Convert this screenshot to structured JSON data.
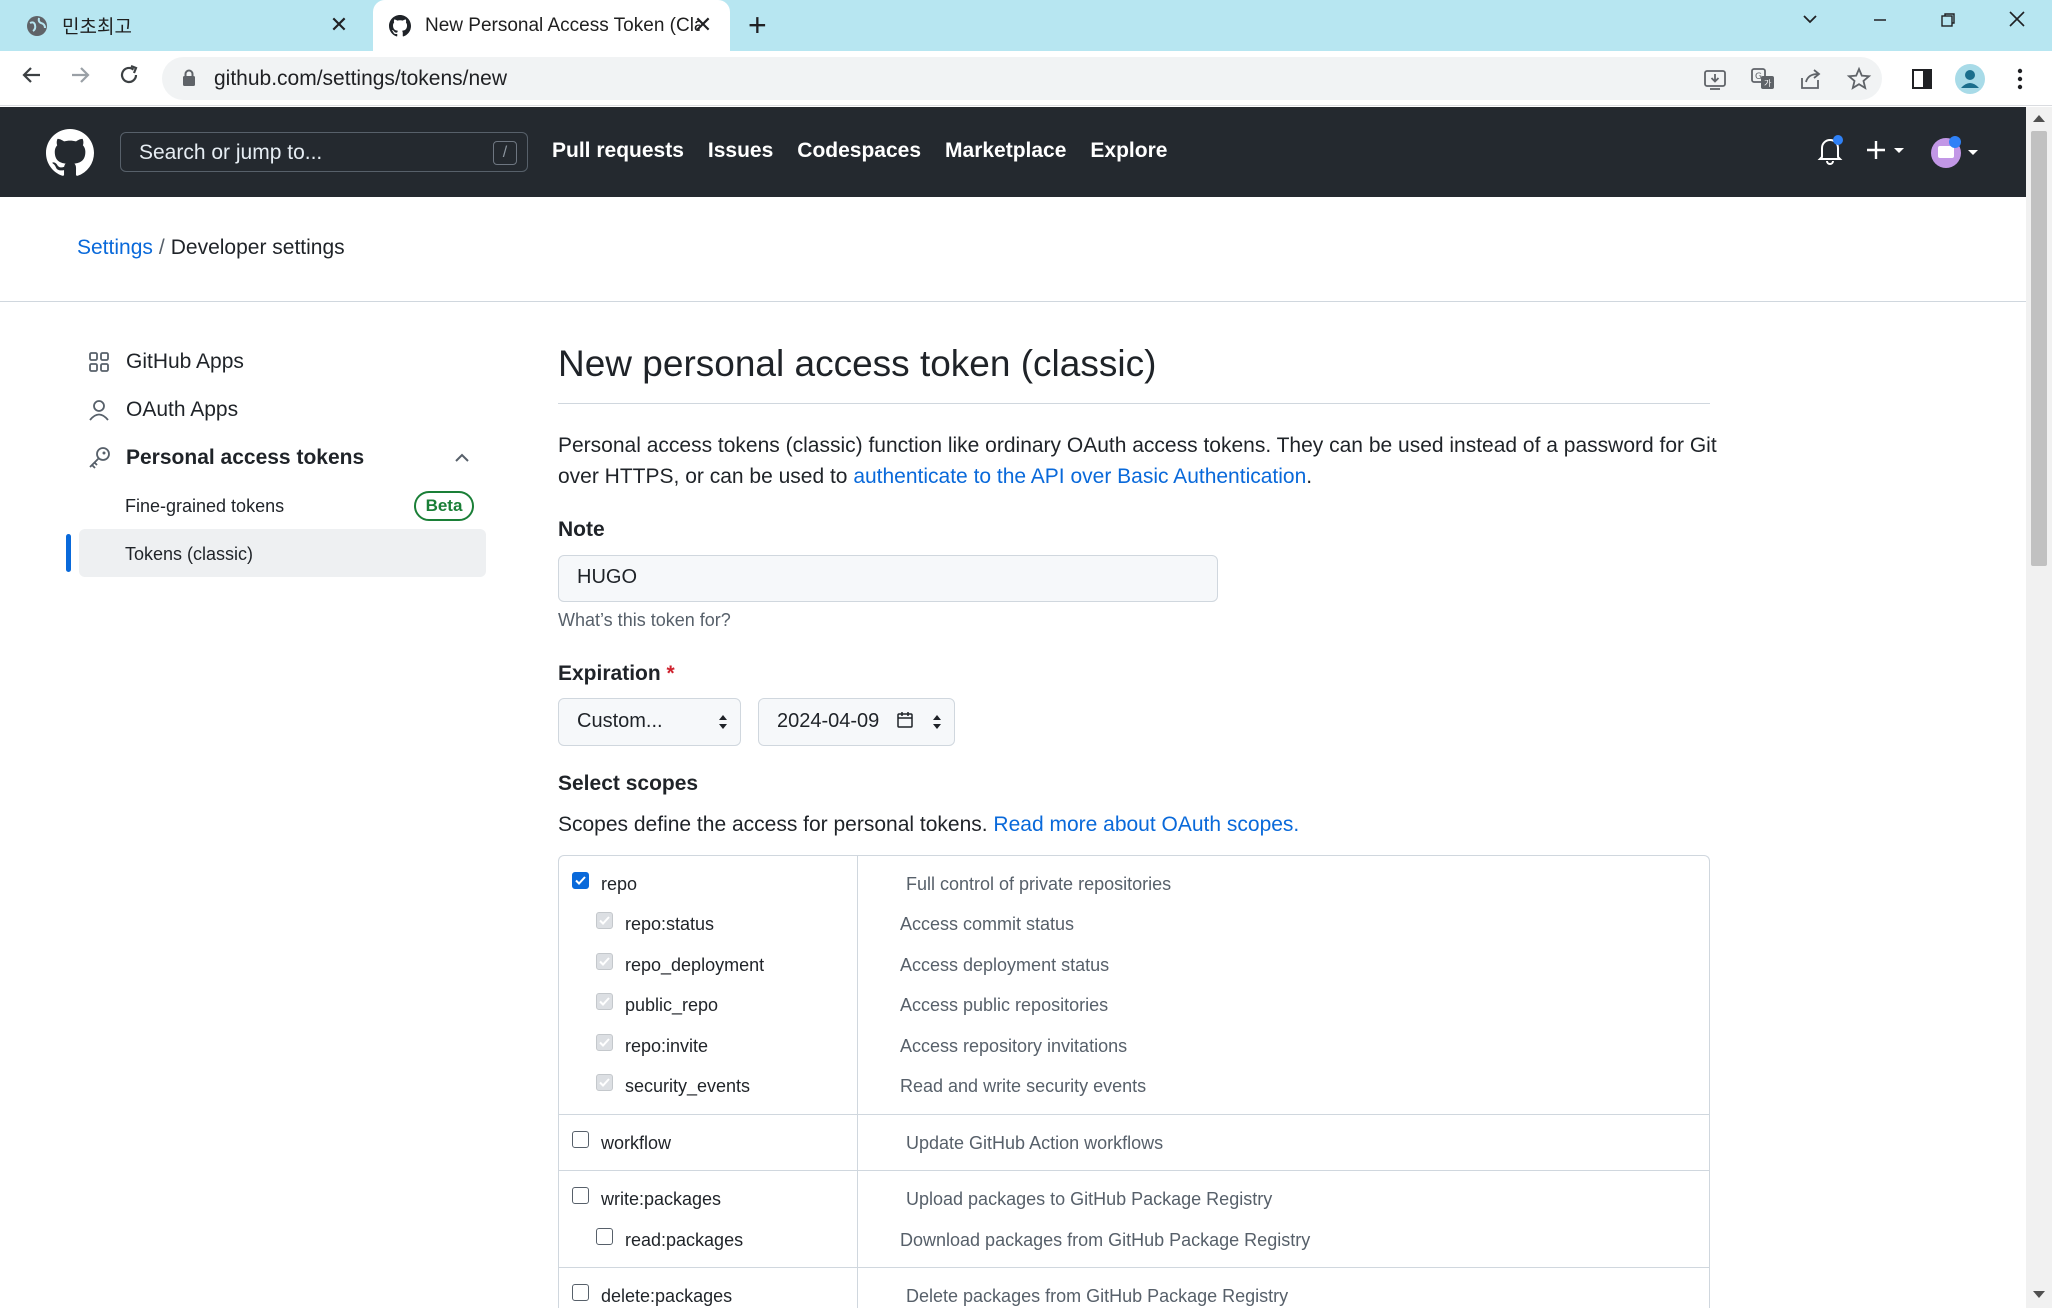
{
  "browser": {
    "tabs": [
      {
        "title": "민초최고",
        "active": false
      },
      {
        "title": "New Personal Access Token (Classic)",
        "active": true
      }
    ],
    "url": "github.com/settings/tokens/new"
  },
  "header": {
    "search_placeholder": "Search or jump to...",
    "search_shortcut": "/",
    "nav": [
      "Pull requests",
      "Issues",
      "Codespaces",
      "Marketplace",
      "Explore"
    ]
  },
  "breadcrumb": {
    "parent": "Settings",
    "separator": "/",
    "current": "Developer settings"
  },
  "sidebar": {
    "items": [
      "GitHub Apps",
      "OAuth Apps",
      "Personal access tokens"
    ],
    "subitems": [
      "Fine-grained tokens",
      "Tokens (classic)"
    ],
    "beta_badge": "Beta"
  },
  "main": {
    "title": "New personal access token (classic)",
    "description_prefix": "Personal access tokens (classic) function like ordinary OAuth access tokens. They can be used instead of a password for Git over HTTPS, or can be used to ",
    "description_link": "authenticate to the API over Basic Authentication",
    "description_suffix": ".",
    "note_label": "Note",
    "note_value": "HUGO",
    "note_hint": "What’s this token for?",
    "expiration_label": "Expiration",
    "required_mark": "*",
    "expiration_select": "Custom...",
    "expiration_date": "2024-04-09",
    "scopes_label": "Select scopes",
    "scopes_desc": "Scopes define the access for personal tokens. ",
    "scopes_link": "Read more about OAuth scopes."
  },
  "scopes": [
    {
      "name": "repo",
      "desc": "Full control of private repositories",
      "checked": true
    },
    {
      "name": "repo:status",
      "desc": "Access commit status",
      "checked": true,
      "child": true
    },
    {
      "name": "repo_deployment",
      "desc": "Access deployment status",
      "checked": true,
      "child": true
    },
    {
      "name": "public_repo",
      "desc": "Access public repositories",
      "checked": true,
      "child": true
    },
    {
      "name": "repo:invite",
      "desc": "Access repository invitations",
      "checked": true,
      "child": true
    },
    {
      "name": "security_events",
      "desc": "Read and write security events",
      "checked": true,
      "child": true
    },
    {
      "name": "workflow",
      "desc": "Update GitHub Action workflows",
      "checked": false
    },
    {
      "name": "write:packages",
      "desc": "Upload packages to GitHub Package Registry",
      "checked": false
    },
    {
      "name": "read:packages",
      "desc": "Download packages from GitHub Package Registry",
      "checked": false,
      "child": true
    },
    {
      "name": "delete:packages",
      "desc": "Delete packages from GitHub Package Registry",
      "checked": false
    }
  ],
  "colors": {
    "accent": "#0969da",
    "header_bg": "#24292f",
    "tabbar_bg": "#b7e6f1",
    "beta": "#1a7f37",
    "required": "#cf222e"
  }
}
